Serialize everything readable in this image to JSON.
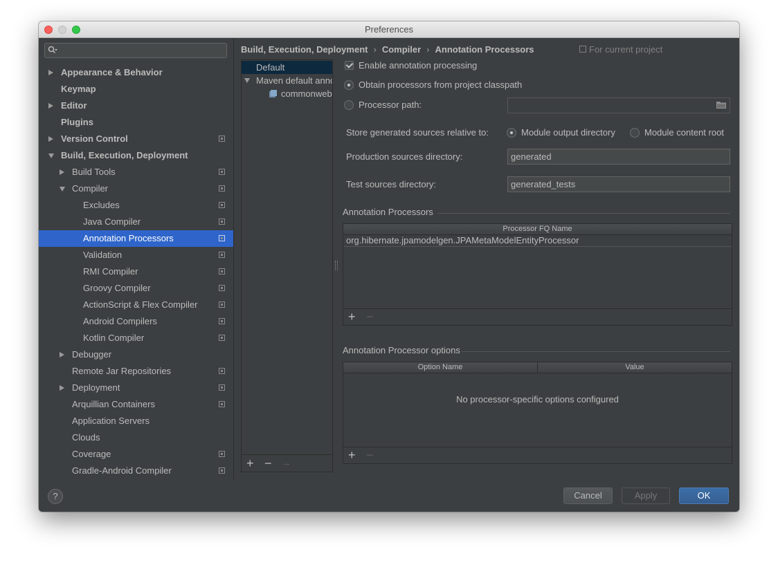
{
  "window": {
    "title": "Preferences"
  },
  "sidebar": {
    "search_placeholder": "",
    "items": [
      {
        "label": "Appearance & Behavior",
        "bold": true,
        "arrow": "right",
        "indent": 0
      },
      {
        "label": "Keymap",
        "bold": true,
        "arrow": "",
        "indent": 0
      },
      {
        "label": "Editor",
        "bold": true,
        "arrow": "right",
        "indent": 0
      },
      {
        "label": "Plugins",
        "bold": true,
        "arrow": "",
        "indent": 0
      },
      {
        "label": "Version Control",
        "bold": true,
        "arrow": "right",
        "indent": 0,
        "project": true
      },
      {
        "label": "Build, Execution, Deployment",
        "bold": true,
        "arrow": "down",
        "indent": 0
      },
      {
        "label": "Build Tools",
        "arrow": "right",
        "indent": 1,
        "project": true
      },
      {
        "label": "Compiler",
        "arrow": "down",
        "indent": 1,
        "project": true
      },
      {
        "label": "Excludes",
        "indent": 2,
        "project": true
      },
      {
        "label": "Java Compiler",
        "indent": 2,
        "project": true
      },
      {
        "label": "Annotation Processors",
        "indent": 2,
        "project": true,
        "selected": true
      },
      {
        "label": "Validation",
        "indent": 2,
        "project": true
      },
      {
        "label": "RMI Compiler",
        "indent": 2,
        "project": true
      },
      {
        "label": "Groovy Compiler",
        "indent": 2,
        "project": true
      },
      {
        "label": "ActionScript & Flex Compiler",
        "indent": 2,
        "project": true
      },
      {
        "label": "Android Compilers",
        "indent": 2,
        "project": true
      },
      {
        "label": "Kotlin Compiler",
        "indent": 2,
        "project": true
      },
      {
        "label": "Debugger",
        "arrow": "right",
        "indent": 1
      },
      {
        "label": "Remote Jar Repositories",
        "indent": 1,
        "project": true
      },
      {
        "label": "Deployment",
        "arrow": "right",
        "indent": 1,
        "project": true
      },
      {
        "label": "Arquillian Containers",
        "indent": 1,
        "project": true
      },
      {
        "label": "Application Servers",
        "indent": 1
      },
      {
        "label": "Clouds",
        "indent": 1
      },
      {
        "label": "Coverage",
        "indent": 1,
        "project": true
      },
      {
        "label": "Gradle-Android Compiler",
        "indent": 1,
        "project": true
      }
    ]
  },
  "breadcrumb": {
    "parts": [
      "Build, Execution, Deployment",
      "Compiler",
      "Annotation Processors"
    ],
    "scope": "For current project"
  },
  "profiles": {
    "items": [
      {
        "label": "Default",
        "selected": true
      },
      {
        "label": "Maven default annotation processors profile",
        "arrow": "down"
      },
      {
        "label": "commonweb"
      }
    ],
    "toolbar": {
      "add": "+",
      "remove": "−",
      "move": "→"
    }
  },
  "settings": {
    "enable_label": "Enable annotation processing",
    "enable_checked": true,
    "obtain_label": "Obtain processors from project classpath",
    "processor_path_label": "Processor path:",
    "processor_path_value": "",
    "store_label": "Store generated sources relative to:",
    "module_output_label": "Module output directory",
    "module_content_label": "Module content root",
    "production_label": "Production sources directory:",
    "production_value": "generated",
    "test_label": "Test sources directory:",
    "test_value": "generated_tests"
  },
  "processors_table": {
    "title": "Annotation Processors",
    "header": "Processor FQ Name",
    "rows": [
      "org.hibernate.jpamodelgen.JPAMetaModelEntityProcessor"
    ],
    "add": "+",
    "remove": "−"
  },
  "options_table": {
    "title": "Annotation Processor options",
    "headers": [
      "Option Name",
      "Value"
    ],
    "empty_message": "No processor-specific options configured",
    "add": "+",
    "remove": "−"
  },
  "footer": {
    "help": "?",
    "cancel": "Cancel",
    "apply": "Apply",
    "ok": "OK"
  },
  "colors": {
    "background": "#3c3f41",
    "selection": "#2f65ca",
    "primary_button": "#365f93",
    "text": "#bbbbbb"
  }
}
